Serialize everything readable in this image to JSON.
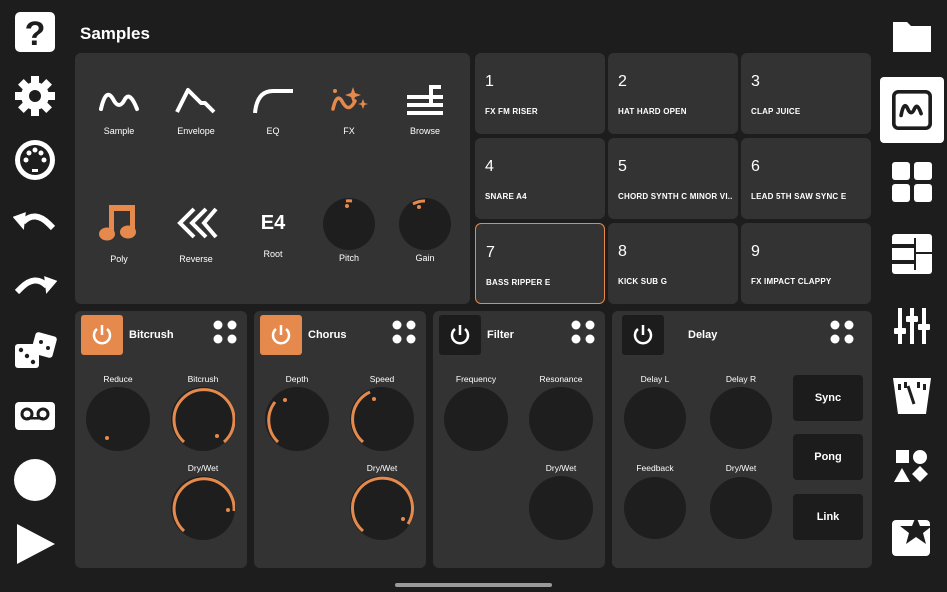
{
  "header": {
    "title": "Samples"
  },
  "left_toolbar": [
    "help-icon",
    "settings-icon",
    "midi-icon",
    "undo-icon",
    "redo-icon",
    "dice-icon",
    "tape-icon",
    "record-icon",
    "play-icon"
  ],
  "right_toolbar": [
    "folder-icon",
    "sample-wave-icon",
    "grid-icon",
    "keyboard-icon",
    "mixer-icon",
    "metronome-icon",
    "shapes-icon",
    "star-icon"
  ],
  "tools": {
    "sample": "Sample",
    "envelope": "Envelope",
    "eq": "EQ",
    "fx": "FX",
    "browse": "Browse",
    "poly": "Poly",
    "reverse": "Reverse",
    "root_value": "E4",
    "root": "Root",
    "pitch": "Pitch",
    "gain": "Gain"
  },
  "pads": [
    {
      "num": "1",
      "name": "FX FM RISER"
    },
    {
      "num": "2",
      "name": "HAT HARD OPEN"
    },
    {
      "num": "3",
      "name": "CLAP JUICE"
    },
    {
      "num": "4",
      "name": "SNARE A4"
    },
    {
      "num": "5",
      "name": "CHORD SYNTH C MINOR VI..."
    },
    {
      "num": "6",
      "name": "LEAD 5TH SAW SYNC E"
    },
    {
      "num": "7",
      "name": "BASS RIPPER E"
    },
    {
      "num": "8",
      "name": "KICK SUB G"
    },
    {
      "num": "9",
      "name": "FX IMPACT CLAPPY"
    }
  ],
  "effects": {
    "bitcrush": {
      "name": "Bitcrush",
      "reduce": "Reduce",
      "bitcrush": "Bitcrush",
      "drywet": "Dry/Wet"
    },
    "chorus": {
      "name": "Chorus",
      "depth": "Depth",
      "speed": "Speed",
      "drywet": "Dry/Wet"
    },
    "filter": {
      "name": "Filter",
      "frequency": "Frequency",
      "resonance": "Resonance",
      "drywet": "Dry/Wet"
    },
    "delay": {
      "name": "Delay",
      "delay_l": "Delay L",
      "delay_r": "Delay R",
      "feedback": "Feedback",
      "drywet": "Dry/Wet",
      "sync": "Sync",
      "pong": "Pong",
      "link": "Link"
    }
  },
  "colors": {
    "accent": "#e58a4c",
    "panel": "#333333",
    "background": "#1d1d1d"
  }
}
